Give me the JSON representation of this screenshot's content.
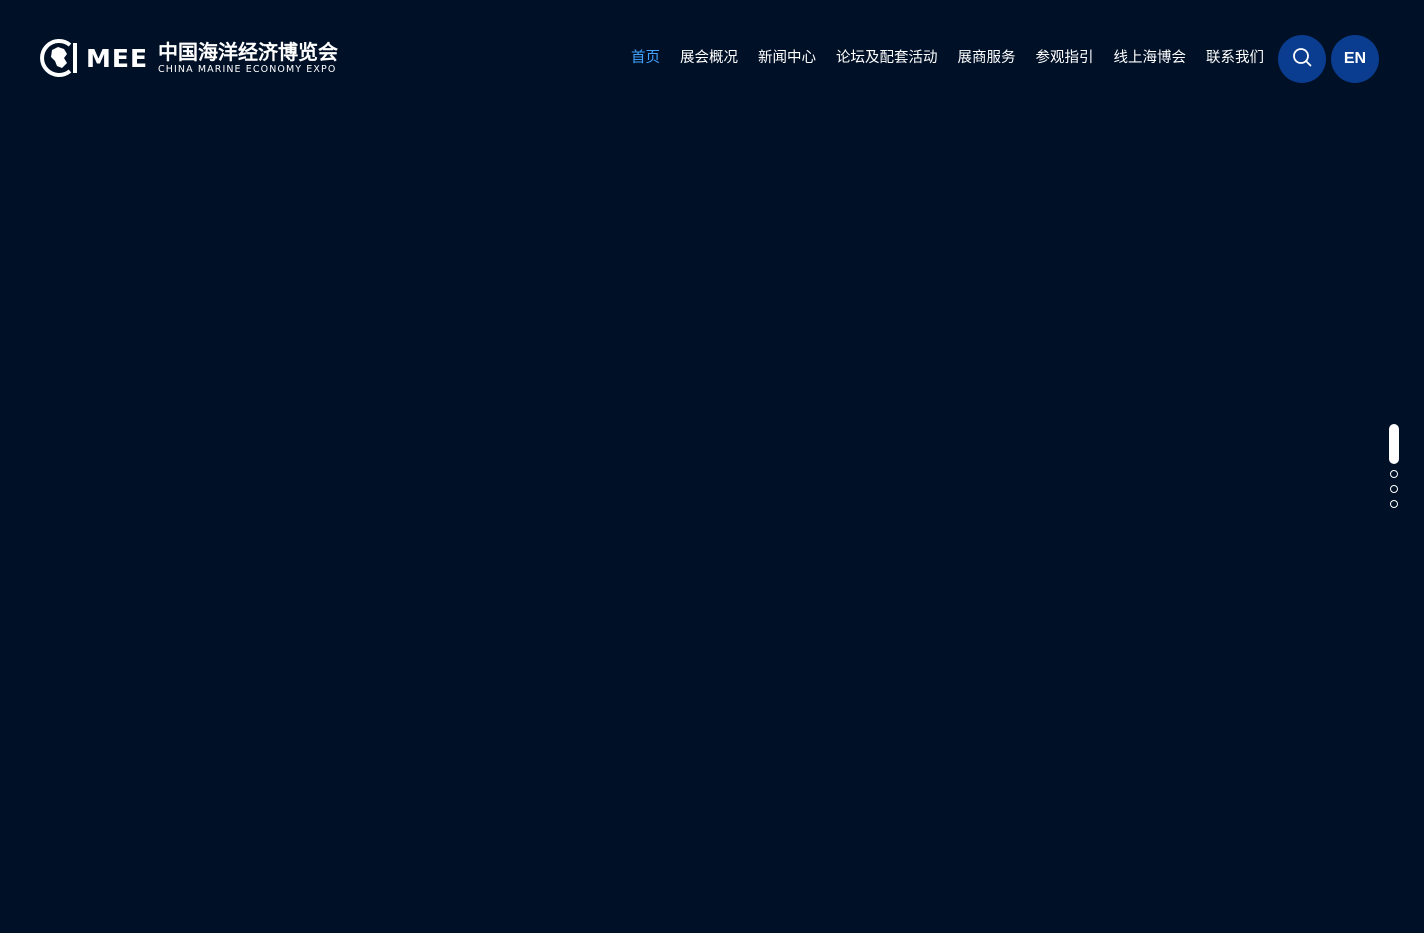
{
  "logo": {
    "abbr": "MEE",
    "title_cn": "中国海洋经济博览会",
    "title_en": "CHINA MARINE ECONOMY EXPO"
  },
  "nav": {
    "items": [
      {
        "label": "首页",
        "active": true
      },
      {
        "label": "展会概况",
        "active": false
      },
      {
        "label": "新闻中心",
        "active": false
      },
      {
        "label": "论坛及配套活动",
        "active": false
      },
      {
        "label": "展商服务",
        "active": false
      },
      {
        "label": "参观指引",
        "active": false
      },
      {
        "label": "线上海博会",
        "active": false
      },
      {
        "label": "联系我们",
        "active": false
      }
    ],
    "search_icon": "search-icon",
    "lang_label": "EN"
  },
  "pager": {
    "total": 4,
    "current": 1
  },
  "colors": {
    "background": "#001027",
    "nav_active": "#3fa3ff",
    "button_bg": "#0a3d8f",
    "text": "#ffffff"
  }
}
